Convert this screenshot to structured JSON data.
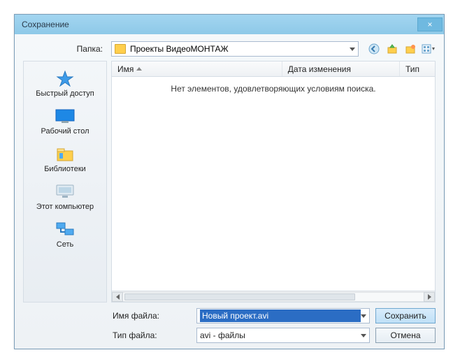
{
  "titlebar": {
    "title": "Сохранение",
    "close_label": "×"
  },
  "folder": {
    "label": "Папка:",
    "selected": "Проекты ВидеоМОНТАЖ",
    "tool_icons": {
      "back": "back-icon",
      "up": "folder-up-icon",
      "new": "new-folder-icon",
      "view": "view-menu-icon"
    }
  },
  "places": [
    {
      "id": "quick-access",
      "label": "Быстрый доступ"
    },
    {
      "id": "desktop",
      "label": "Рабочий стол"
    },
    {
      "id": "libraries",
      "label": "Библиотеки"
    },
    {
      "id": "this-pc",
      "label": "Этот компьютер"
    },
    {
      "id": "network",
      "label": "Сеть"
    }
  ],
  "columns": {
    "name": "Имя",
    "date": "Дата изменения",
    "type": "Тип"
  },
  "empty_message": "Нет элементов, удовлетворяющих условиям поиска.",
  "filename": {
    "label": "Имя файла:",
    "value": "Новый проект.avi"
  },
  "filetype": {
    "label": "Тип файла:",
    "value": "avi - файлы"
  },
  "buttons": {
    "save": "Сохранить",
    "cancel": "Отмена"
  }
}
